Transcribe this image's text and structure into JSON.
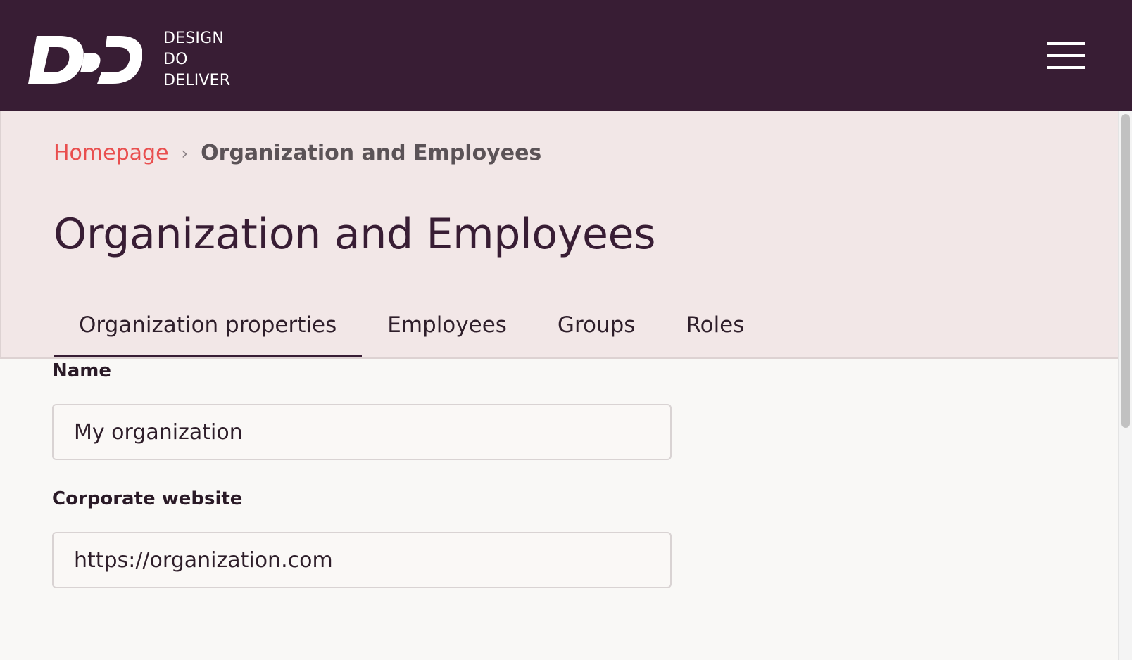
{
  "header": {
    "logo_lines": [
      "DESIGN",
      "DO",
      "DELIVER"
    ],
    "brand_color": "#381d34"
  },
  "breadcrumb": {
    "home_label": "Homepage",
    "separator": "›",
    "current_label": "Organization and Employees",
    "link_color": "#e94f4f"
  },
  "page": {
    "title": "Organization and Employees"
  },
  "tabs": [
    {
      "label": "Organization properties",
      "active": true
    },
    {
      "label": "Employees",
      "active": false
    },
    {
      "label": "Groups",
      "active": false
    },
    {
      "label": "Roles",
      "active": false
    }
  ],
  "form": {
    "name": {
      "label": "Name",
      "value": "My organization"
    },
    "website": {
      "label": "Corporate website",
      "value": "https://organization.com"
    }
  }
}
